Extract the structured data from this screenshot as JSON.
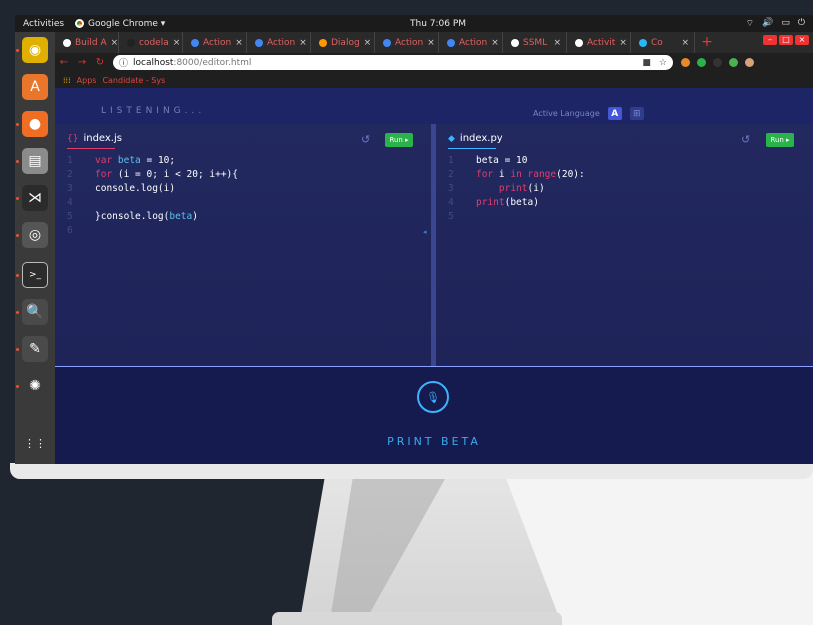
{
  "system_bar": {
    "activities": "Activities",
    "app_menu": "Google Chrome ▾",
    "clock": "Thu 7:06 PM",
    "tray_icons": [
      "wifi-icon",
      "volume-icon",
      "battery-icon",
      "power-icon"
    ]
  },
  "dock": {
    "items": [
      {
        "name": "rhythmbox-icon",
        "color": "#e0b000",
        "glyph": "◉"
      },
      {
        "name": "software-center-icon",
        "color": "#e9762b",
        "glyph": "A"
      },
      {
        "name": "firefox-icon",
        "color": "#f06d24",
        "glyph": "●"
      },
      {
        "name": "files-icon",
        "color": "#8b8b8b",
        "glyph": "▤"
      },
      {
        "name": "vscode-icon",
        "color": "#2b2b2b",
        "glyph": "⋊"
      },
      {
        "name": "chrome-icon",
        "color": "#555555",
        "glyph": "◎"
      },
      {
        "name": "terminal-icon",
        "color": "#2c2c2c",
        "glyph": ">_"
      },
      {
        "name": "image-viewer-icon",
        "color": "#4a4a4a",
        "glyph": "🔍"
      },
      {
        "name": "text-editor-icon",
        "color": "#4a4a4a",
        "glyph": "✎"
      },
      {
        "name": "settings-icon",
        "color": "#3a3a3a",
        "glyph": "✺"
      },
      {
        "name": "show-apps-icon",
        "color": "#3a3a3a",
        "glyph": "⋮⋮"
      }
    ]
  },
  "browser": {
    "tabs": [
      {
        "label": "Build A",
        "icon_color": "#ffffff"
      },
      {
        "label": "codela",
        "icon_color": "#222222"
      },
      {
        "label": "Action",
        "icon_color": "#4285f4"
      },
      {
        "label": "Action",
        "icon_color": "#4285f4"
      },
      {
        "label": "Dialog",
        "icon_color": "#ff9800"
      },
      {
        "label": "Action",
        "icon_color": "#4285f4"
      },
      {
        "label": "Action",
        "icon_color": "#4285f4"
      },
      {
        "label": "SSML",
        "icon_color": "#ffffff"
      },
      {
        "label": "Activit",
        "icon_color": "#ffffff"
      },
      {
        "label": "Co",
        "icon_color": "#29b6f6"
      }
    ],
    "tab_close": "×",
    "new_tab": "+",
    "url": {
      "host": "localhost",
      "path": ":8000/editor.html"
    },
    "bookmarks": [
      "Apps",
      "Candidate - Sys"
    ]
  },
  "app": {
    "listening": "LISTENING...",
    "active_language_label": "Active Language",
    "lang_a": "A",
    "lang_b": "⊞",
    "left": {
      "filename": "index.js",
      "file_icon": "{}",
      "run_label": "Run ▸",
      "lines": [
        [
          {
            "t": "var ",
            "c": "kw"
          },
          {
            "t": "beta",
            "c": "var"
          },
          {
            "t": " = 10;",
            "c": "plain"
          }
        ],
        [
          {
            "t": "for ",
            "c": "kw"
          },
          {
            "t": "(i = 0; i < 20; i++){",
            "c": "plain"
          }
        ],
        [
          {
            "t": "console.log(i)",
            "c": "plain"
          }
        ],
        [],
        [
          {
            "t": "}console.log(",
            "c": "plain"
          },
          {
            "t": "beta",
            "c": "var"
          },
          {
            "t": ")",
            "c": "plain"
          }
        ],
        []
      ]
    },
    "right": {
      "filename": "index.py",
      "file_icon": "◆",
      "run_label": "Run ▸",
      "lines": [
        [
          {
            "t": "beta = 10",
            "c": "plain"
          }
        ],
        [
          {
            "t": "for ",
            "c": "kw"
          },
          {
            "t": "i ",
            "c": "plain"
          },
          {
            "t": "in ",
            "c": "kw"
          },
          {
            "t": "range",
            "c": "fn"
          },
          {
            "t": "(20):",
            "c": "plain"
          }
        ],
        [
          {
            "t": "    ",
            "c": "plain"
          },
          {
            "t": "print",
            "c": "fn"
          },
          {
            "t": "(i)",
            "c": "plain"
          }
        ],
        [
          {
            "t": "print",
            "c": "fn"
          },
          {
            "t": "(beta)",
            "c": "plain"
          }
        ],
        []
      ]
    },
    "transcript": "PRINT BETA",
    "mic_glyph": "🎙",
    "colors": {
      "accent": "#3db3ff",
      "run": "#2ab34a",
      "keyword": "#e13d6c",
      "variable": "#5bc0eb",
      "js_icon": "#e13d6c",
      "py_icon": "#3db3ff"
    }
  }
}
